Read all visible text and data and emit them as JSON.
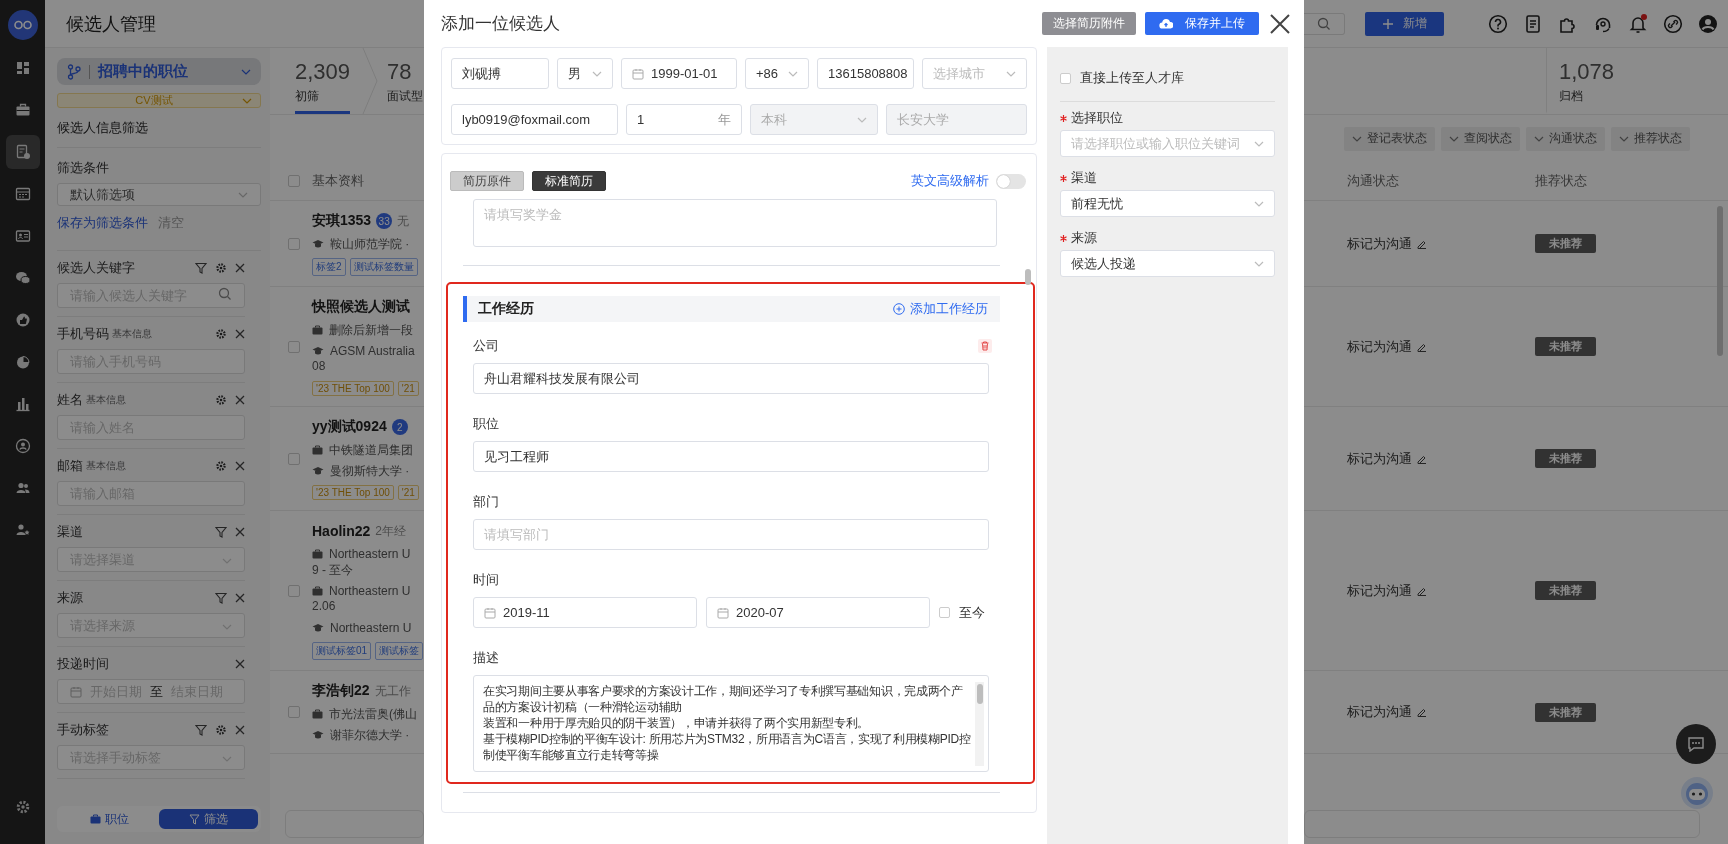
{
  "sidebar_rail": {
    "items": [
      {
        "selected": false
      },
      {
        "selected": false
      },
      {
        "selected": true
      },
      {
        "selected": false
      },
      {
        "selected": false
      },
      {
        "selected": false
      },
      {
        "selected": false
      },
      {
        "selected": false
      },
      {
        "selected": false
      },
      {
        "selected": false
      },
      {
        "selected": false
      },
      {
        "selected": false
      }
    ]
  },
  "filter_panel": {
    "title": "候选人管理",
    "job_selector": "招聘中的职位",
    "job_tag": "CV测试",
    "section_title": "候选人信息筛选",
    "preset": {
      "label": "筛选条件",
      "value": "默认筛选项"
    },
    "save_link": "保存为筛选条件",
    "clear_link": "清空",
    "filters": [
      {
        "label": "候选人关键字",
        "kind": "search",
        "placeholder": "请输入候选人关键字",
        "filterable": true,
        "configurable": true,
        "removable": true
      },
      {
        "label": "手机号码",
        "tag": "基本信息",
        "kind": "text",
        "placeholder": "请输入手机号码",
        "filterable": false,
        "configurable": true,
        "removable": true
      },
      {
        "label": "姓名",
        "tag": "基本信息",
        "kind": "text",
        "placeholder": "请输入姓名",
        "filterable": false,
        "configurable": true,
        "removable": true
      },
      {
        "label": "邮箱",
        "tag": "基本信息",
        "kind": "text",
        "placeholder": "请输入邮箱",
        "filterable": false,
        "configurable": true,
        "removable": true
      },
      {
        "label": "渠道",
        "kind": "select",
        "placeholder": "请选择渠道",
        "filterable": true,
        "configurable": false,
        "removable": true
      },
      {
        "label": "来源",
        "kind": "select",
        "placeholder": "请选择来源",
        "filterable": true,
        "configurable": false,
        "removable": true
      },
      {
        "label": "投递时间",
        "kind": "daterange",
        "start_placeholder": "开始日期",
        "separator": "至",
        "end_placeholder": "结束日期",
        "filterable": false,
        "configurable": false,
        "removable": true
      },
      {
        "label": "手动标签",
        "kind": "select",
        "placeholder": "请选择手动标签",
        "filterable": true,
        "configurable": true,
        "removable": true
      }
    ],
    "bottom_tabs": [
      {
        "label": "职位",
        "selected": false
      },
      {
        "label": "筛选",
        "selected": true
      }
    ]
  },
  "header": {
    "new_button": "新增",
    "has_notification": true
  },
  "stages": [
    {
      "value": "2,309",
      "label": "初筛",
      "selected": true
    },
    {
      "value": "78",
      "label": "面试型",
      "selected": false
    },
    {
      "value": "1,078",
      "label": "归档",
      "selected": false
    }
  ],
  "status_filters": [
    "登记表状态",
    "查阅状态",
    "沟通状态",
    "推荐状态"
  ],
  "table": {
    "select_all": {
      "checked": false
    },
    "columns": [
      "基本资料",
      "沟通状态",
      "推荐状态"
    ],
    "rows": [
      {
        "checked": false,
        "name": "安琪1353",
        "badge": "33",
        "note": "无",
        "lines": [
          {
            "kind": "school",
            "text": "鞍山师范学院 ·"
          }
        ],
        "tags": [
          {
            "text": "标签2",
            "kind": "label"
          },
          {
            "text": "测试标签数量",
            "kind": "label"
          }
        ],
        "contact": "标记为沟通",
        "recommend": "未推荐"
      },
      {
        "checked": false,
        "name": "快照候选人测试",
        "lines": [
          {
            "kind": "work",
            "text": "删除后新增一段"
          },
          {
            "kind": "school",
            "text": "AGSM Australia",
            "more": "08"
          }
        ],
        "tags": [
          {
            "text": "'23 THE Top 100",
            "kind": "ranking"
          },
          {
            "text": "'21",
            "kind": "ranking"
          }
        ],
        "contact": "标记为沟通",
        "recommend": "未推荐"
      },
      {
        "checked": false,
        "name": "yy测试0924",
        "badge": "2",
        "lines": [
          {
            "kind": "work",
            "text": "中铁隧道局集团"
          },
          {
            "kind": "school",
            "text": "曼彻斯特大学 ·"
          }
        ],
        "tags": [
          {
            "text": "'23 THE Top 100",
            "kind": "ranking"
          },
          {
            "text": "'21",
            "kind": "ranking"
          }
        ],
        "contact": "标记为沟通",
        "recommend": "未推荐"
      },
      {
        "checked": false,
        "name": "Haolin22",
        "note": "2年经",
        "lines": [
          {
            "kind": "work",
            "text": "Northeastern U",
            "more": "9 - 至今"
          },
          {
            "kind": "work",
            "text": "Northeastern U",
            "more": "2.06"
          },
          {
            "kind": "school",
            "text": "Northeastern U"
          }
        ],
        "tags": [
          {
            "text": "测试标签01",
            "kind": "label"
          },
          {
            "text": "测试标签",
            "kind": "label"
          }
        ],
        "contact": "标记为沟通",
        "recommend": "未推荐"
      },
      {
        "checked": false,
        "name": "李浩钊22",
        "note": "无工作",
        "lines": [
          {
            "kind": "work",
            "text": "市光法雷奥(佛山"
          },
          {
            "kind": "school",
            "text": "谢菲尔德大学 ·"
          }
        ],
        "tags": [],
        "contact": "标记为沟通",
        "recommend": "未推荐"
      }
    ]
  },
  "modal": {
    "title": "添加一位候选人",
    "buttons": [
      {
        "label": "选择简历附件",
        "kind": "secondary"
      },
      {
        "label": "保存并上传",
        "kind": "primary"
      }
    ],
    "basic_info": {
      "name": {
        "kind": "text",
        "value": "刘砚搏",
        "disabled": false
      },
      "gender": {
        "kind": "select",
        "value": "男",
        "disabled": false
      },
      "birth_date": {
        "kind": "date",
        "value": "1999-01-01",
        "disabled": false
      },
      "phone_code": {
        "kind": "select",
        "value": "+86",
        "disabled": false
      },
      "phone": {
        "kind": "text",
        "value": "13615808808",
        "disabled": false
      },
      "city": {
        "kind": "select",
        "placeholder": "选择城市",
        "disabled": false
      },
      "email": {
        "kind": "text",
        "value": "lyb0919@foxmail.com",
        "disabled": false
      },
      "experience": {
        "kind": "number",
        "value": "1",
        "suffix": "年",
        "disabled": false
      },
      "education": {
        "kind": "select",
        "value": "本科",
        "disabled": true
      },
      "school": {
        "kind": "text",
        "value": "长安大学",
        "disabled": true
      }
    },
    "resume": {
      "tabs": [
        {
          "label": "简历原件",
          "selected": false
        },
        {
          "label": "标准简历",
          "selected": true
        }
      ],
      "parse_link": "英文高级解析",
      "parse_toggle": {
        "on": false
      },
      "scholarship": {
        "placeholder": "请填写奖学金"
      }
    },
    "work_experience": {
      "title": "工作经历",
      "add_link": "添加工作经历",
      "fields": [
        {
          "label": "公司",
          "kind": "text",
          "value": "舟山君耀科技发展有限公司"
        },
        {
          "label": "职位",
          "kind": "text",
          "value": "见习工程师"
        },
        {
          "label": "部门",
          "kind": "text",
          "placeholder": "请填写部门"
        },
        {
          "label": "时间",
          "kind": "daterange",
          "start": "2019-11",
          "end": "2020-07",
          "until_now": {
            "label": "至今",
            "checked": false
          }
        },
        {
          "label": "描述",
          "kind": "textarea",
          "paragraphs": [
            "在实习期间主要从事客户要求的方案设计工作，期间还学习了专利撰写基础知识，完成两个产品的方案设计初稿（一种滑轮运动辅助",
            "装置和一种用于厚壳贻贝的阴干装置），申请并获得了两个实用新型专利。",
            "基于模糊PID控制的平衡车设计: 所用芯片为STM32，所用语言为C语言，实现了利用模糊PID控制使平衡车能够直立行走转弯等操"
          ]
        }
      ]
    },
    "side": {
      "upload_to_pool": {
        "label": "直接上传至人才库",
        "checked": false
      },
      "fields": [
        {
          "label": "选择职位",
          "required": true,
          "placeholder": "请选择职位或输入职位关键词"
        },
        {
          "label": "渠道",
          "required": true,
          "value": "前程无忧"
        },
        {
          "label": "来源",
          "required": true,
          "value": "候选人投递"
        }
      ]
    }
  }
}
